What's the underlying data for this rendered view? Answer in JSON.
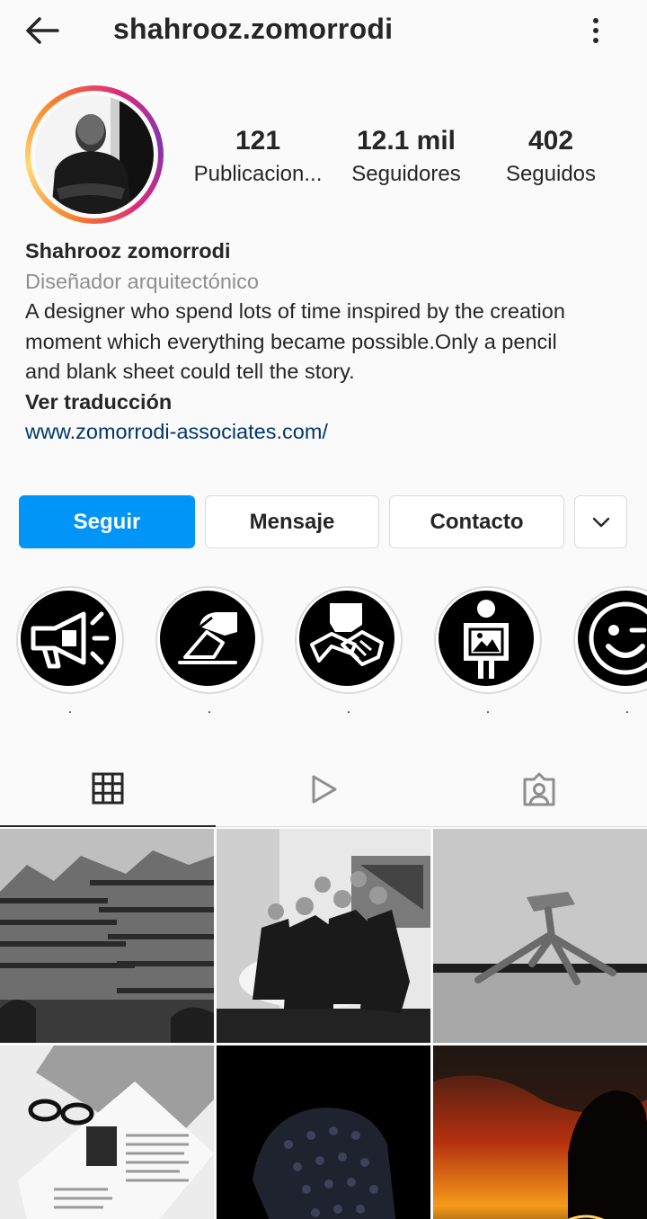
{
  "header": {
    "username": "shahrooz.zomorrodi",
    "back_icon": "arrow-left-icon",
    "more_icon": "more-vertical-icon"
  },
  "stats": {
    "posts": {
      "value": "121",
      "label": "Publicacion..."
    },
    "followers": {
      "value": "12.1 mil",
      "label": "Seguidores"
    },
    "following": {
      "value": "402",
      "label": "Seguidos"
    }
  },
  "bio": {
    "name": "Shahrooz zomorrodi",
    "category": "Diseñador arquitectónico",
    "lines": [
      "A designer who spend lots of time inspired by the creation",
      "moment which everything became possible.Only a pencil",
      "and blank sheet could tell the story."
    ],
    "translate": "Ver traducción",
    "website": "www.zomorrodi-associates.com/"
  },
  "actions": {
    "follow": "Seguir",
    "message": "Mensaje",
    "contact": "Contacto",
    "expand_icon": "chevron-down-icon"
  },
  "highlights": [
    {
      "label": ".",
      "icon": "megaphone-icon"
    },
    {
      "label": ".",
      "icon": "ballot-vote-icon"
    },
    {
      "label": ".",
      "icon": "handshake-icon"
    },
    {
      "label": ".",
      "icon": "person-holding-picture-icon"
    },
    {
      "label": ".",
      "icon": "wink-face-icon"
    }
  ],
  "tabs": [
    {
      "icon": "grid-icon",
      "active": true
    },
    {
      "icon": "reels-play-icon",
      "active": false
    },
    {
      "icon": "tagged-user-icon",
      "active": false
    }
  ],
  "posts": [
    {
      "subject": "building-photo"
    },
    {
      "subject": "team-photo"
    },
    {
      "subject": "sculpture-photo"
    },
    {
      "subject": "magazine-photo"
    },
    {
      "subject": "tufted-chair-photo"
    },
    {
      "subject": "sunset-photo"
    }
  ],
  "colors": {
    "accent": "#0095f6",
    "link": "#00376b",
    "secondary_text": "#8e8e8e",
    "text": "#262626",
    "border": "#dbdbdb"
  }
}
